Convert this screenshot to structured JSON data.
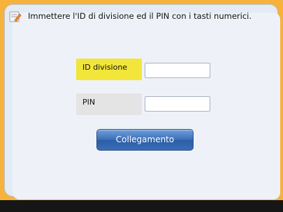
{
  "message": {
    "icon": "info-edit-icon",
    "text": "Immettere l'ID di divisione ed il PIN con i tasti numerici."
  },
  "form": {
    "division_id_label": "ID divisione",
    "division_id_value": "",
    "pin_label": "PIN",
    "pin_value": ""
  },
  "login_button_label": "Collegamento",
  "colors": {
    "frame": "#f6b23a",
    "panel": "#e4ebf5",
    "active_label": "#f2e63a",
    "inactive_label": "#e4e4e4",
    "button": "#3d70b8",
    "bottom_bar": "#161616"
  }
}
